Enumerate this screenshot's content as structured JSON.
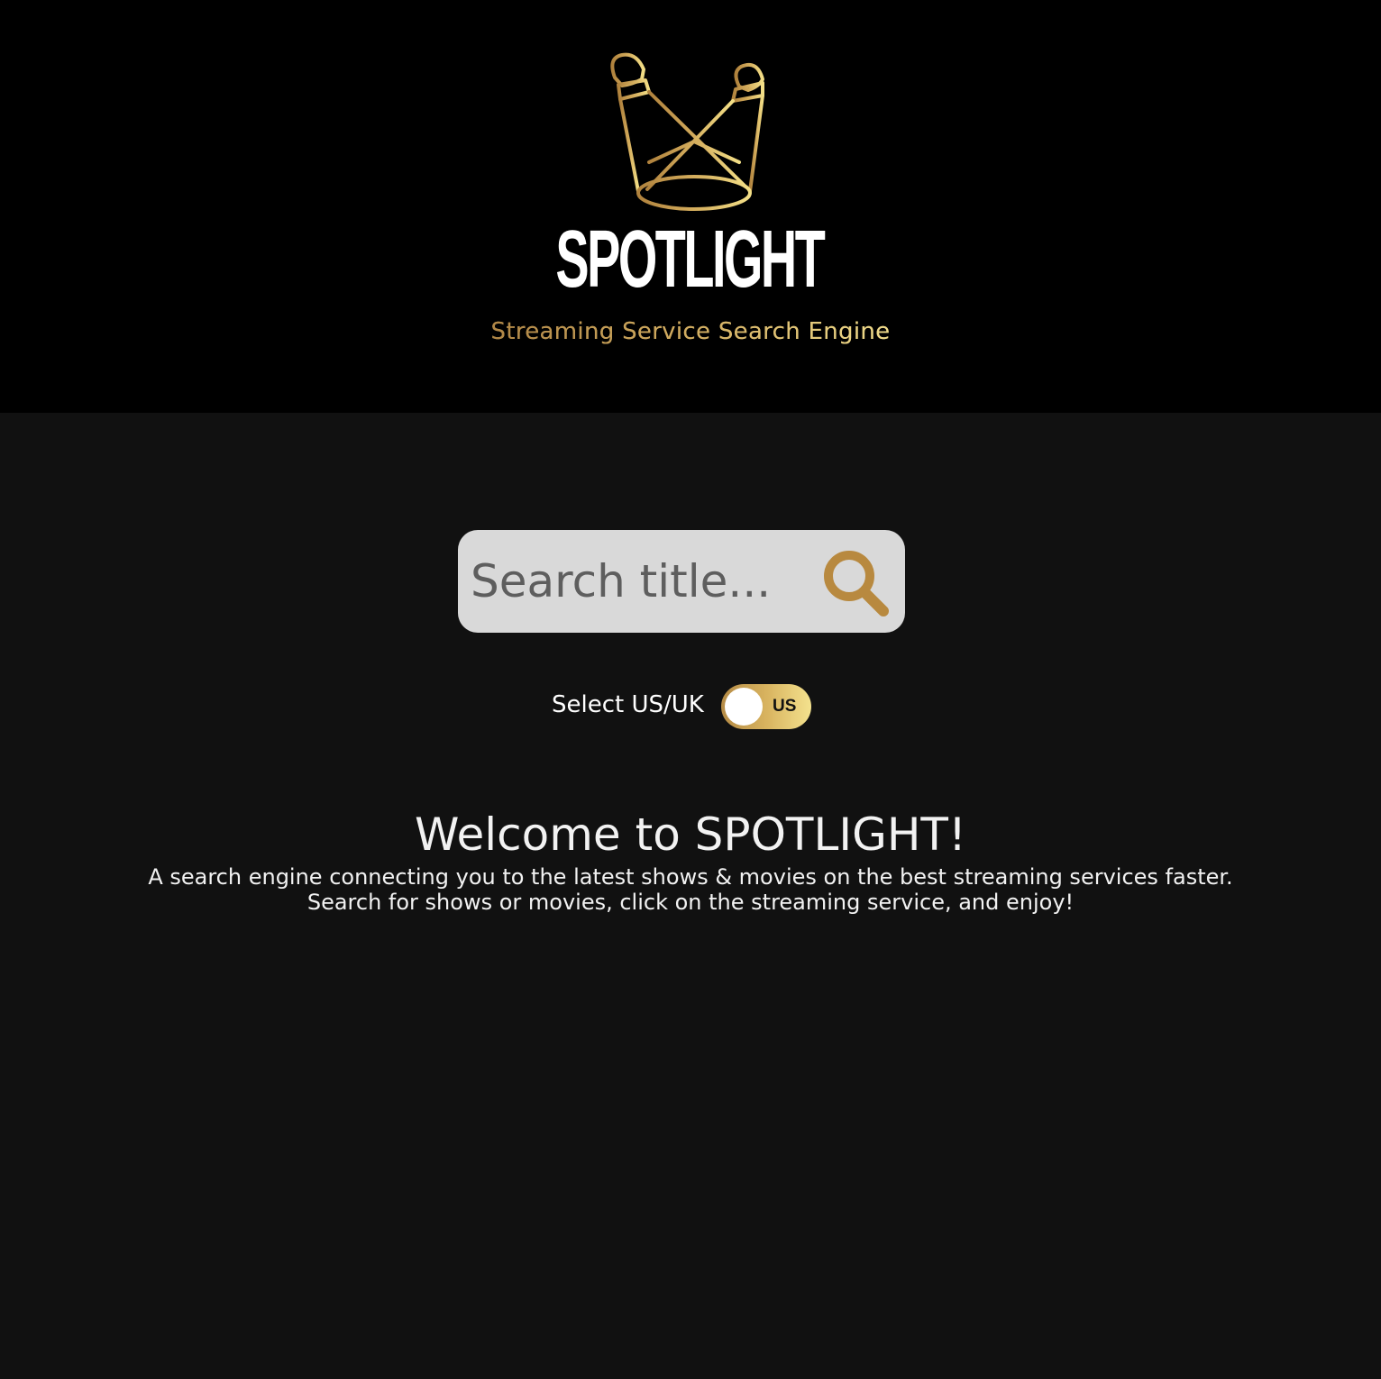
{
  "header": {
    "brand": "SPOTLIGHT",
    "tagline": "Streaming Service Search Engine"
  },
  "search": {
    "placeholder": "Search title...",
    "value": ""
  },
  "region": {
    "label": "Select US/UK",
    "toggle_value": "US"
  },
  "welcome": {
    "title": "Welcome to SPOTLIGHT!",
    "line1": "A search engine connecting you to the latest shows & movies on the best streaming services faster.",
    "line2": "Search for shows or movies, click on the streaming service, and enjoy!"
  },
  "colors": {
    "header_bg": "#000000",
    "page_bg": "#111111",
    "gold_dark": "#b58b46",
    "gold_light": "#f4e28e",
    "search_bg": "#d9d9d9",
    "search_icon": "#b8893f"
  },
  "icons": {
    "logo": "spotlight-logo-icon",
    "search": "search-icon"
  }
}
